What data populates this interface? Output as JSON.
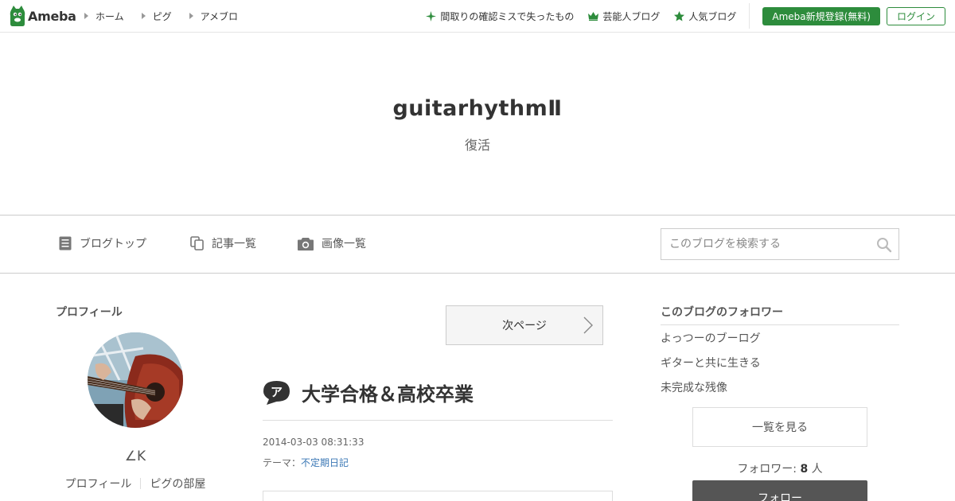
{
  "header": {
    "logo_text": "Ameba",
    "nav": [
      {
        "label": "ホーム"
      },
      {
        "label": "ピグ"
      },
      {
        "label": "アメブロ"
      }
    ],
    "right_links": [
      {
        "label": "間取りの確認ミスで失ったもの",
        "icon": "sparkle-icon"
      },
      {
        "label": "芸能人ブログ",
        "icon": "crown-icon"
      },
      {
        "label": "人気ブログ",
        "icon": "star-icon"
      }
    ],
    "register_label": "Ameba新規登録(無料)",
    "login_label": "ログイン",
    "accent_color": "#2d8c3c"
  },
  "blog": {
    "title": "guitarhythmⅡ",
    "subtitle": "復活"
  },
  "blog_nav": {
    "items": [
      {
        "label": "ブログトップ",
        "icon": "document-icon"
      },
      {
        "label": "記事一覧",
        "icon": "copy-icon"
      },
      {
        "label": "画像一覧",
        "icon": "camera-icon"
      }
    ],
    "search_placeholder": "このブログを検索する"
  },
  "profile": {
    "heading": "プロフィール",
    "name": "∠K",
    "links": [
      "プロフィール",
      "ピグの部屋"
    ]
  },
  "entry": {
    "next_page_label": "次ページ",
    "title": "大学合格＆高校卒業",
    "date": "2014-03-03 08:31:33",
    "theme_prefix": "テーマ：",
    "theme": "不定期日記"
  },
  "followers": {
    "heading": "このブログのフォロワー",
    "items": [
      "よっつーのブーログ",
      "ギターと共に生きる",
      "未完成な残像"
    ],
    "view_all_label": "一覧を見る",
    "count_prefix": "フォロワー: ",
    "count": "8",
    "count_suffix": " 人",
    "follow_label": "フォロー"
  }
}
